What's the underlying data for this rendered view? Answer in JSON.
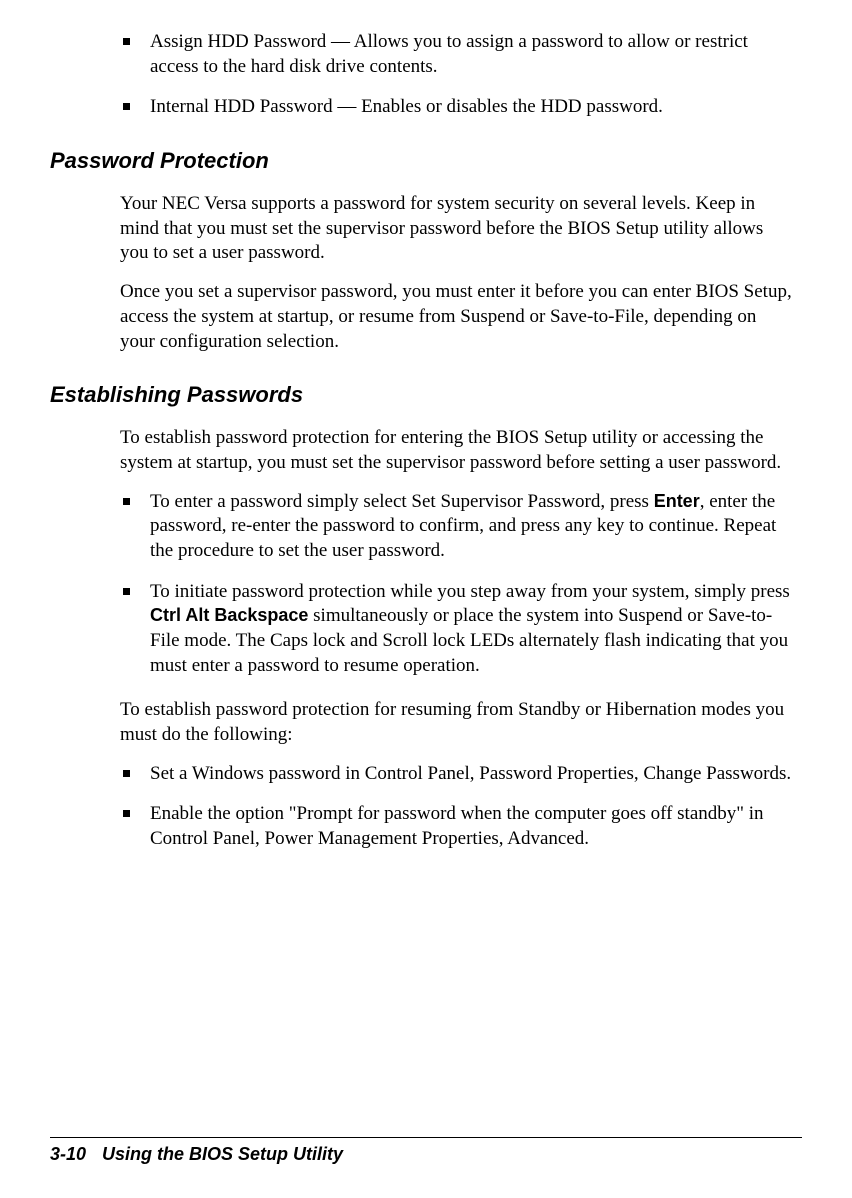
{
  "top_bullets": [
    "Assign HDD Password — Allows you to assign a password to allow or restrict access to the hard disk drive contents.",
    "Internal HDD Password — Enables or disables the HDD password."
  ],
  "section1": {
    "heading": "Password Protection",
    "para1": "Your NEC Versa supports a password for system security on several levels. Keep in mind that you must set the supervisor password before the BIOS Setup utility allows you to set a user password.",
    "para2": "Once you set a supervisor password, you must enter it before you can enter BIOS Setup, access the system at startup, or resume from Suspend or Save-to-File, depending on your configuration selection."
  },
  "section2": {
    "heading": "Establishing Passwords",
    "para1": "To establish password protection for entering the BIOS Setup utility or accessing the system at startup, you must set the supervisor password before setting a user password.",
    "bullets1": {
      "item1_pre": "To enter a password simply select Set Supervisor Password, press ",
      "item1_key": "Enter",
      "item1_post": ", enter the password, re-enter the password to confirm, and press any key to continue. Repeat the procedure to set the user password.",
      "item2_pre": "To initiate password protection while you step away from your system, simply press ",
      "item2_key": "Ctrl Alt Backspace",
      "item2_post": " simultaneously or place the system into Suspend or Save-to-File mode. The Caps lock and Scroll lock LEDs alternately flash indicating that you must enter a password to resume operation."
    },
    "para2": "To establish password protection for resuming from Standby or Hibernation modes you must do the following:",
    "bullets2": [
      "Set a Windows password in Control Panel, Password Properties, Change Passwords.",
      "Enable the option \"Prompt for password when the computer goes off standby\" in Control Panel, Power Management Properties, Advanced."
    ]
  },
  "footer": {
    "page": "3-10",
    "title": "Using the BIOS Setup Utility"
  }
}
